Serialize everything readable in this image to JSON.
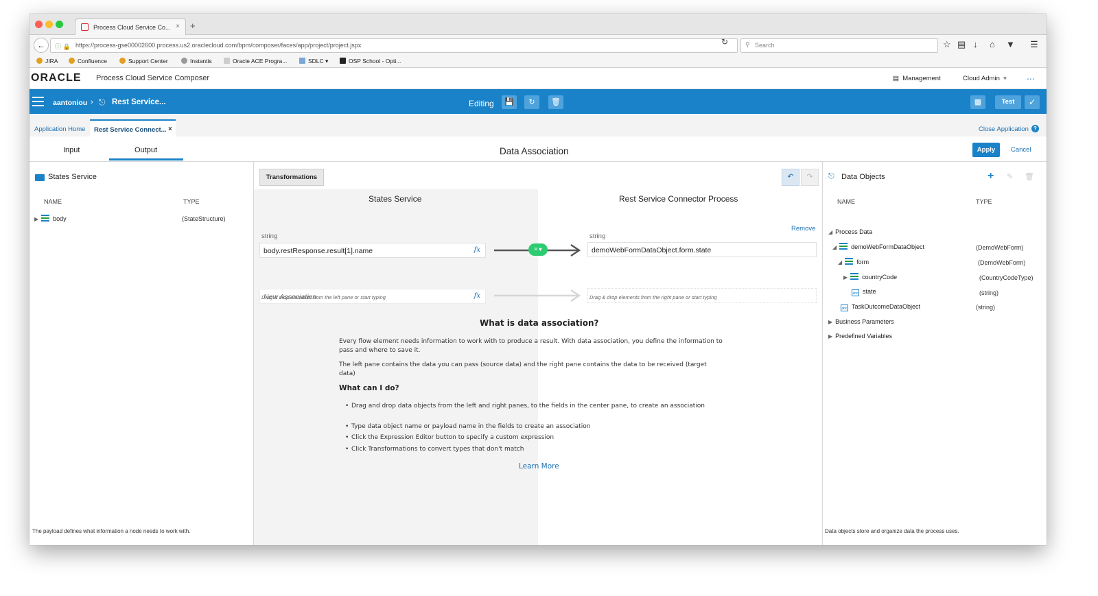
{
  "browser": {
    "tab_title": "Process Cloud Service Co...",
    "tab_close": "×",
    "new_tab": "+",
    "url": "https://process-gse00002600.process.us2.oraclecloud.com/bpm/composer/faces/app/project/project.jspx",
    "search_placeholder": "Search",
    "bookmarks": [
      "JIRA",
      "Confluence",
      "Support Center",
      "Instantis",
      "Oracle ACE Progra...",
      "SDLC",
      "OSP School - Opti..."
    ]
  },
  "header": {
    "logo": "ORACLE",
    "product": "Process Cloud Service Composer",
    "management": "Management",
    "user_menu": "Cloud Admin",
    "more": "..."
  },
  "toolbar": {
    "user": "aantoniou",
    "separator": "›",
    "process_name": "Rest Service...",
    "mode": "Editing",
    "test_label": "Test"
  },
  "app_tabs": {
    "home": "Application Home",
    "active": "Rest Service Connect...",
    "close": "×",
    "close_application": "Close Application"
  },
  "subheader": {
    "tabs": [
      "Input",
      "Output"
    ],
    "active_tab": "Output",
    "title": "Data Association",
    "apply": "Apply",
    "cancel": "Cancel"
  },
  "left_pane": {
    "title": "States Service",
    "col_name": "NAME",
    "col_type": "TYPE",
    "items": [
      {
        "name": "body",
        "type": "(StateStructure)"
      }
    ],
    "footnote": "The payload defines what information a node needs to work with."
  },
  "center": {
    "transformations": "Transformations",
    "source_title": "States Service",
    "target_title": "Rest Service Connector Process",
    "remove": "Remove",
    "source_type": "string",
    "target_type": "string",
    "source_expr": "body.restResponse.result[1].name",
    "target_expr": "demoWebFormDataObject.form.state",
    "fx": "fx",
    "mapping_operator": "= ▾",
    "new_association": "New Association",
    "hint_left": "Drag & drop elements from the left pane or start typing",
    "hint_right": "Drag & drop elements from the right pane or start typing"
  },
  "help": {
    "title": "What is data association?",
    "p1": "Every flow element needs information to work with to produce a result. With data association, you define the information to pass and where to save it.",
    "p2": "The left pane contains the data you can pass (source data) and the right pane contains the data to be received (target data)",
    "subtitle": "What can I do?",
    "bullets": [
      "Drag and drop data objects from the left and right panes, to the fields in the center pane, to create an association",
      "Type data object name or payload name in the fields to create an association",
      "Click the Expression Editor button to specify a custom expression",
      "Click Transformations to convert types that don't match"
    ],
    "learn_more": "Learn More"
  },
  "right_pane": {
    "title": "Data Objects",
    "col_name": "NAME",
    "col_type": "TYPE",
    "tree": [
      {
        "name": "Process Data",
        "type": ""
      },
      {
        "name": "demoWebFormDataObject",
        "type": "(DemoWebForm)"
      },
      {
        "name": "form",
        "type": "(DemoWebForm)"
      },
      {
        "name": "countryCode",
        "type": "(CountryCodeType)"
      },
      {
        "name": "state",
        "type": "(string)"
      },
      {
        "name": "TaskOutcomeDataObject",
        "type": "(string)"
      },
      {
        "name": "Business Parameters",
        "type": ""
      },
      {
        "name": "Predefined Variables",
        "type": ""
      }
    ],
    "footnote": "Data objects store and organize data the process uses."
  },
  "colors": {
    "brand_blue": "#1a82c8",
    "mapping_green": "#2ecc71"
  }
}
